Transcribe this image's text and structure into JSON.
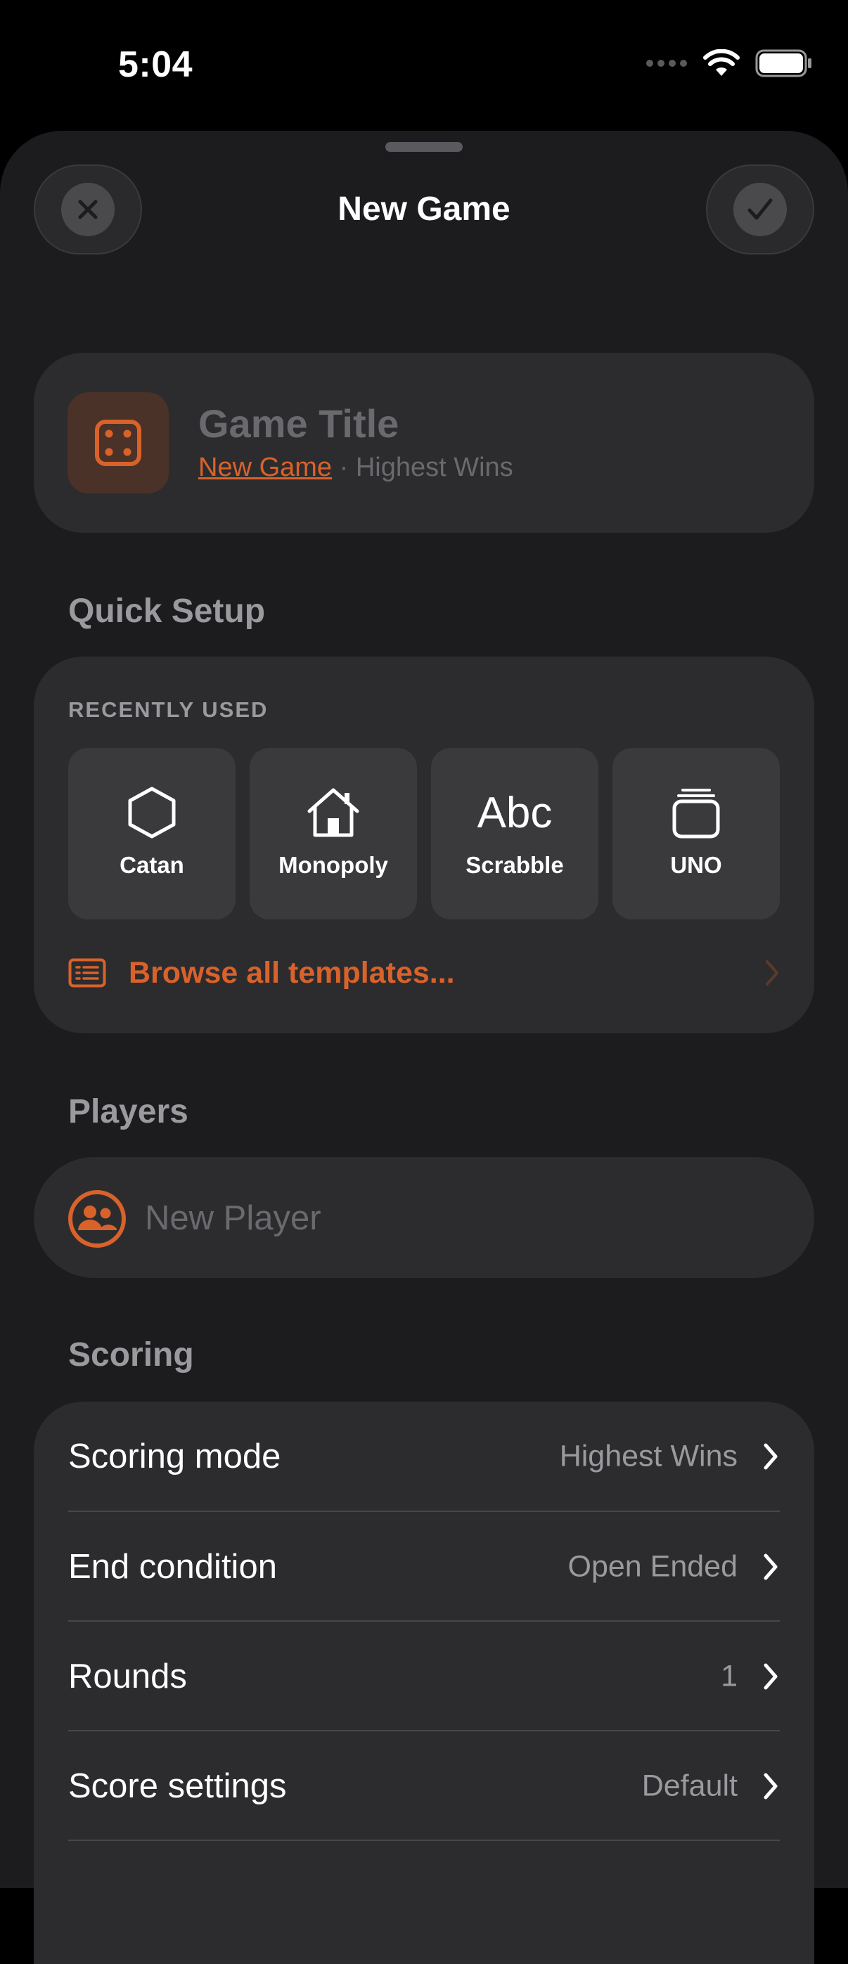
{
  "status_bar": {
    "time": "5:04"
  },
  "header": {
    "title": "New Game"
  },
  "game_card": {
    "title_placeholder": "Game Title",
    "subtitle_link": "New Game",
    "subtitle_separator": "·",
    "subtitle_mode": "Highest Wins"
  },
  "quick_setup": {
    "heading": "Quick Setup",
    "recent_label": "RECENTLY USED",
    "templates": [
      {
        "label": "Catan",
        "icon": "hexagon-icon"
      },
      {
        "label": "Monopoly",
        "icon": "house-icon"
      },
      {
        "label": "Scrabble",
        "icon_text": "Abc"
      },
      {
        "label": "UNO",
        "icon": "cards-stack-icon"
      }
    ],
    "browse_label": "Browse all templates..."
  },
  "players": {
    "heading": "Players",
    "input_placeholder": "New Player"
  },
  "scoring": {
    "heading": "Scoring",
    "rows": [
      {
        "label": "Scoring mode",
        "value": "Highest Wins"
      },
      {
        "label": "End condition",
        "value": "Open Ended"
      },
      {
        "label": "Rounds",
        "value": "1"
      },
      {
        "label": "Score settings",
        "value": "Default"
      }
    ]
  },
  "colors": {
    "accent": "#d9622b",
    "background": "#1c1c1e",
    "card": "#2c2c2e"
  }
}
